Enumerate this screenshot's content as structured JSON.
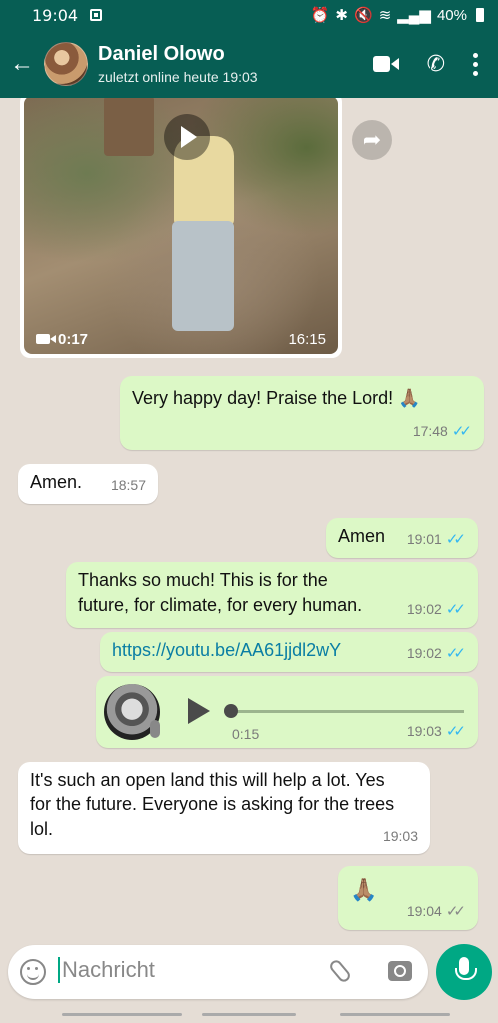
{
  "status": {
    "time": "19:04",
    "battery": "40%"
  },
  "header": {
    "back_icon": "arrow-left-icon",
    "contact_name": "Daniel Olowo",
    "last_seen": "zuletzt online heute 19:03"
  },
  "video": {
    "duration": "0:17",
    "time": "16:15"
  },
  "messages": [
    {
      "text": "Very happy day! Praise the Lord! 🙏🏽",
      "time": "17:48",
      "dir": "out"
    },
    {
      "text": "Amen.",
      "time": "18:57",
      "dir": "in"
    },
    {
      "text": "Amen",
      "time": "19:01",
      "dir": "out"
    },
    {
      "text": "Thanks so much! This is for the future, for climate, for every human.",
      "time": "19:02",
      "dir": "out"
    },
    {
      "text": "https://youtu.be/AA61jjdl2wY",
      "time": "19:02",
      "dir": "out"
    },
    {
      "text": "It's such an open land this will help a lot. Yes for the future. Everyone is asking for the trees lol.",
      "time": "19:03",
      "dir": "in"
    },
    {
      "text": "🙏🏽",
      "time": "19:04",
      "dir": "out"
    }
  ],
  "voice": {
    "duration": "0:15",
    "time": "19:03",
    "progress": 0
  },
  "input": {
    "placeholder": "Nachricht"
  },
  "colors": {
    "header": "#075e54",
    "outgoing": "#dcf8c6",
    "accent": "#00a884",
    "read_tick": "#34b7f1"
  }
}
